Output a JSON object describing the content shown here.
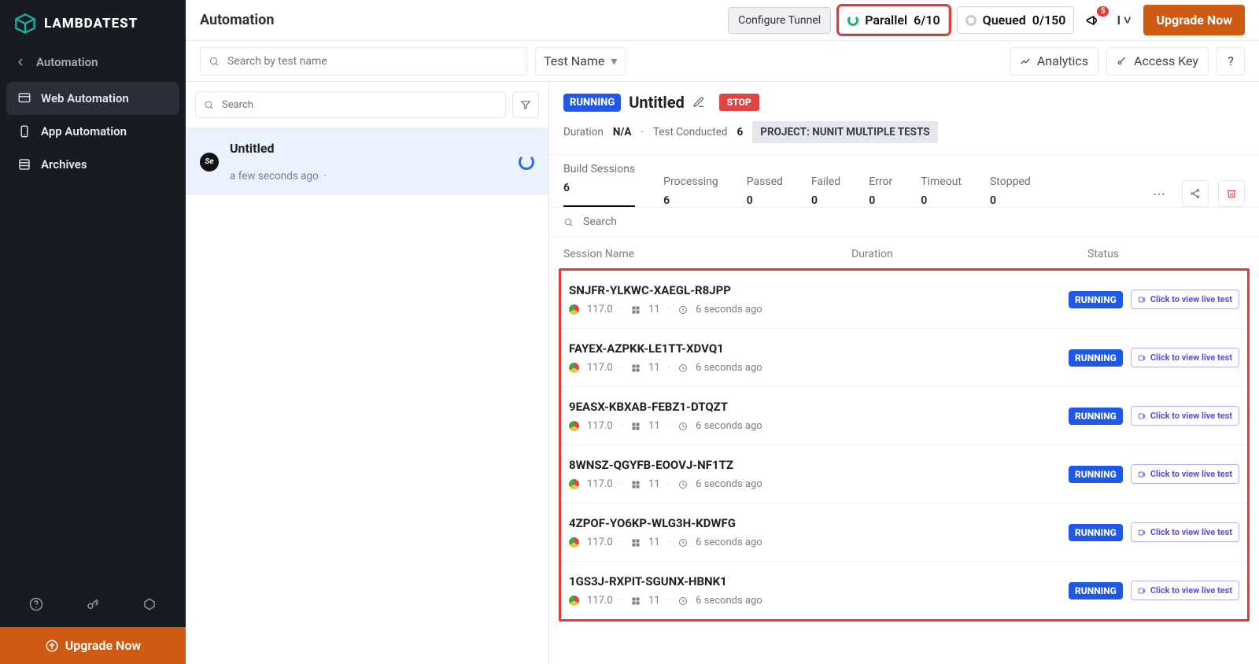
{
  "brand": "LAMBDATEST",
  "sidebar": {
    "head": "Automation",
    "items": [
      {
        "label": "Web Automation",
        "active": true
      },
      {
        "label": "App Automation",
        "active": false
      },
      {
        "label": "Archives",
        "active": false
      }
    ],
    "upgrade": "Upgrade Now"
  },
  "topbar": {
    "title": "Automation",
    "configure": "Configure Tunnel",
    "parallel_label": "Parallel",
    "parallel_value": "6/10",
    "queued_label": "Queued",
    "queued_value": "0/150",
    "bell_badge": "5",
    "menu_caret": "I",
    "upgrade": "Upgrade Now"
  },
  "subbar": {
    "search_placeholder": "Search by test name",
    "select_label": "Test Name",
    "analytics": "Analytics",
    "access_key": "Access Key",
    "help": "?"
  },
  "builds": {
    "search_placeholder": "Search",
    "items": [
      {
        "name": "Untitled",
        "subtitle": "a few seconds ago"
      }
    ]
  },
  "detail": {
    "status_tag": "RUNNING",
    "title": "Untitled",
    "stop": "STOP",
    "duration_label": "Duration",
    "duration_value": "N/A",
    "conducted_label": "Test Conducted",
    "conducted_value": "6",
    "project_chip": "PROJECT: NUNIT MULTIPLE TESTS",
    "stats": [
      {
        "label": "Build Sessions",
        "value": "6",
        "cls": "active"
      },
      {
        "label": "Processing",
        "value": "6",
        "cls": "proc"
      },
      {
        "label": "Passed",
        "value": "0",
        "cls": "pass"
      },
      {
        "label": "Failed",
        "value": "0",
        "cls": "fail"
      },
      {
        "label": "Error",
        "value": "0",
        "cls": "err"
      },
      {
        "label": "Timeout",
        "value": "0",
        "cls": ""
      },
      {
        "label": "Stopped",
        "value": "0",
        "cls": ""
      }
    ],
    "sessions_search_placeholder": "Search",
    "columns": {
      "name": "Session Name",
      "duration": "Duration",
      "status": "Status"
    },
    "sessions": [
      {
        "name": "SNJFR-YLKWC-XAEGL-R8JPP",
        "br": "117.0",
        "os": "11",
        "age": "6 seconds ago",
        "status": "RUNNING",
        "live": "Click to view live test"
      },
      {
        "name": "FAYEX-AZPKK-LE1TT-XDVQ1",
        "br": "117.0",
        "os": "11",
        "age": "6 seconds ago",
        "status": "RUNNING",
        "live": "Click to view live test"
      },
      {
        "name": "9EASX-KBXAB-FEBZ1-DTQZT",
        "br": "117.0",
        "os": "11",
        "age": "6 seconds ago",
        "status": "RUNNING",
        "live": "Click to view live test"
      },
      {
        "name": "8WNSZ-QGYFB-EOOVJ-NF1TZ",
        "br": "117.0",
        "os": "11",
        "age": "6 seconds ago",
        "status": "RUNNING",
        "live": "Click to view live test"
      },
      {
        "name": "4ZPOF-YO6KP-WLG3H-KDWFG",
        "br": "117.0",
        "os": "11",
        "age": "6 seconds ago",
        "status": "RUNNING",
        "live": "Click to view live test"
      },
      {
        "name": "1GS3J-RXPIT-SGUNX-HBNK1",
        "br": "117.0",
        "os": "11",
        "age": "6 seconds ago",
        "status": "RUNNING",
        "live": "Click to view live test"
      }
    ]
  }
}
